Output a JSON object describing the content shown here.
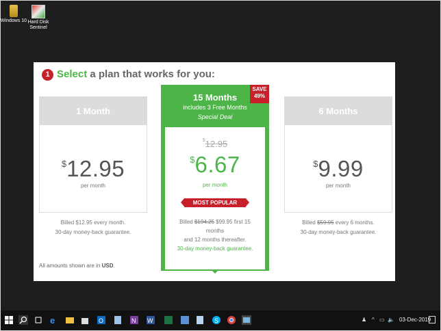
{
  "desktop": {
    "icons": [
      {
        "label_line1": "Windows 10",
        "label_line2": ""
      },
      {
        "label_line1": "Hard Disk",
        "label_line2": "Sentinel"
      }
    ]
  },
  "plan_page": {
    "step_number": "1",
    "title_highlight": "Select",
    "title_rest": " a plan that works for you:",
    "plans": [
      {
        "name": "1 Month",
        "currency": "$",
        "price": "12.95",
        "per": "per month",
        "billing_line1": "Billed $12.95 every month.",
        "billing_line2": "30-day money-back guarantee."
      },
      {
        "name": "15 Months",
        "subtitle": "includes 3 Free Months",
        "deal": "Special Deal",
        "save_line1": "SAVE",
        "save_line2": "49%",
        "old_currency": "$",
        "old_price": "12.95",
        "currency": "$",
        "price": "6.67",
        "per": "per month",
        "badge": "MOST POPULAR",
        "billing_prefix": "Billed ",
        "billing_old": "$194.25",
        "billing_new": " $99.95 first 15",
        "billing_line2": "months",
        "billing_line3": "and 12 months thereafter.",
        "billing_line4": "30-day money-back guarantee."
      },
      {
        "name": "6 Months",
        "currency": "$",
        "price": "9.99",
        "per": "per month",
        "billing_prefix": "Billed ",
        "billing_old": "$59.95",
        "billing_rest": " every 6 months.",
        "billing_line2": "30-day money-back guarantee."
      }
    ],
    "note_prefix": "All amounts shown are in ",
    "note_currency": "USD",
    "note_suffix": "."
  },
  "taskbar": {
    "apps": [
      "start-icon",
      "search-icon",
      "task-view-icon",
      "edge-icon",
      "file-explorer-icon",
      "store-icon",
      "outlook-icon",
      "notepad-icon",
      "onenote-icon",
      "word-icon",
      "excel-icon",
      "word-doc-icon",
      "notes-icon",
      "skype-icon",
      "chrome-icon",
      "app-window-icon"
    ],
    "tray_caret": "^",
    "date": "03-Dec-2019"
  },
  "colors": {
    "accent_green": "#4db548",
    "accent_red": "#c8202a",
    "card_header_gray": "#dcdcdc"
  }
}
